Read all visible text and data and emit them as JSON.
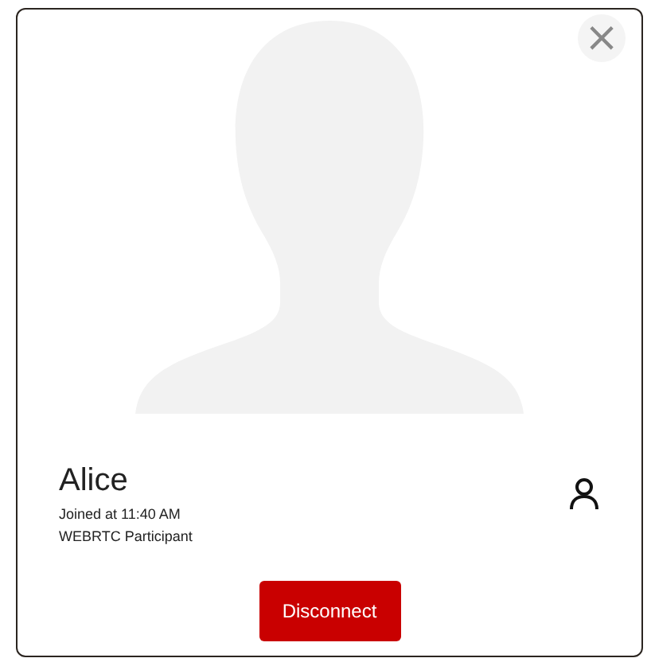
{
  "close_button": {
    "label": "×"
  },
  "participant": {
    "name": "Alice",
    "joined": "Joined at 11:40 AM",
    "type": "WEBRTC Participant"
  },
  "buttons": [
    {
      "label": "Disconnect"
    }
  ]
}
